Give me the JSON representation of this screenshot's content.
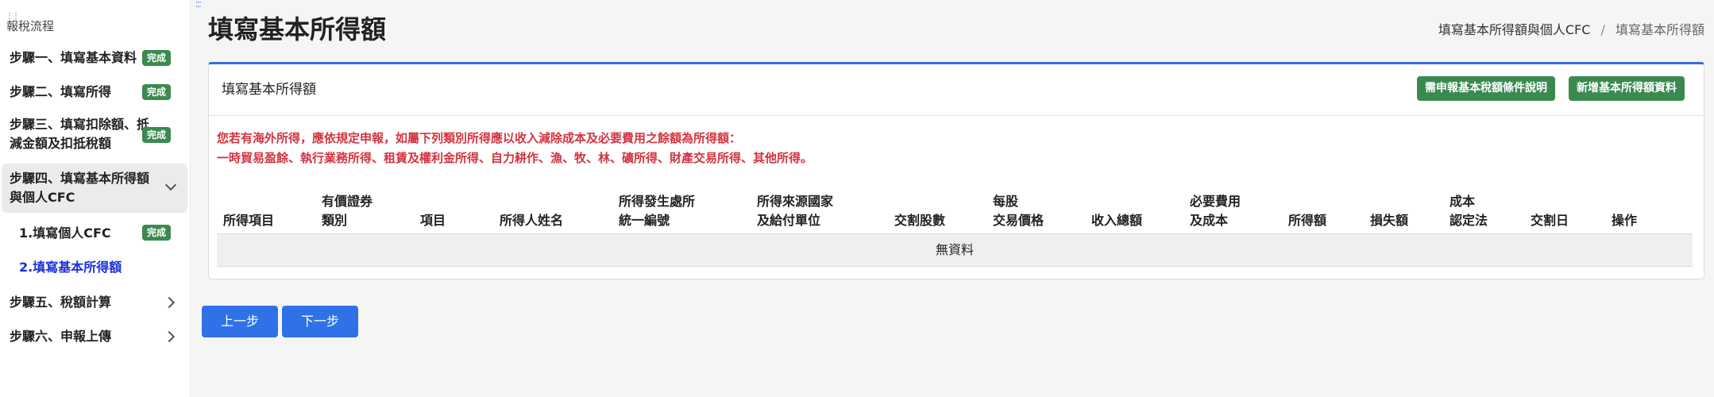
{
  "sidebar": {
    "header": "報稅流程",
    "items": [
      {
        "label": "步驟一、填寫基本資料",
        "badge": "完成"
      },
      {
        "label": "步驟二、填寫所得",
        "badge": "完成"
      },
      {
        "label_line1": "步驟三、填寫扣除額、抵",
        "label_line2": "減金額及扣抵稅額",
        "badge": "完成"
      },
      {
        "label_line1": "步驟四、填寫基本所得額",
        "label_line2": "與個人CFC"
      },
      {
        "label": "步驟五、稅額計算"
      },
      {
        "label": "步驟六、申報上傳"
      }
    ],
    "subitems": [
      {
        "label": "1.填寫個人CFC",
        "badge": "完成"
      },
      {
        "label": "2.填寫基本所得額"
      }
    ]
  },
  "page_title": "填寫基本所得額",
  "breadcrumb": {
    "parent": "填寫基本所得額與個人CFC",
    "separator": "/",
    "current": "填寫基本所得額"
  },
  "card": {
    "title": "填寫基本所得額",
    "buttons": {
      "explain": "需申報基本稅額條件說明",
      "add": "新增基本所得額資料"
    },
    "warning_line1": "您若有海外所得，應依規定申報，如屬下列類別所得應以收入減除成本及必要費用之餘額為所得額：",
    "warning_line2": "一時貿易盈餘、執行業務所得、租賃及權利金所得、自力耕作、漁、牧、林、礦所得、財產交易所得、其他所得。"
  },
  "table": {
    "columns": [
      {
        "l1": "",
        "l2": "所得項目"
      },
      {
        "l1": "有價證券",
        "l2": "類別"
      },
      {
        "l1": "",
        "l2": "項目"
      },
      {
        "l1": "",
        "l2": "所得人姓名"
      },
      {
        "l1": "所得發生處所",
        "l2": "統一編號"
      },
      {
        "l1": "所得來源國家",
        "l2": "及給付單位"
      },
      {
        "l1": "",
        "l2": "交割股數"
      },
      {
        "l1": "每股",
        "l2": "交易價格"
      },
      {
        "l1": "",
        "l2": "收入總額"
      },
      {
        "l1": "必要費用",
        "l2": "及成本"
      },
      {
        "l1": "",
        "l2": "所得額"
      },
      {
        "l1": "",
        "l2": "損失額"
      },
      {
        "l1": "成本",
        "l2": "認定法"
      },
      {
        "l1": "",
        "l2": "交割日"
      },
      {
        "l1": "",
        "l2": "操作"
      }
    ],
    "empty_text": "無資料"
  },
  "nav": {
    "prev": "上一步",
    "next": "下一步"
  },
  "colors": {
    "badge_green": "#3a8a50",
    "primary_blue": "#2f72e8",
    "warning_red": "#d2343f"
  }
}
